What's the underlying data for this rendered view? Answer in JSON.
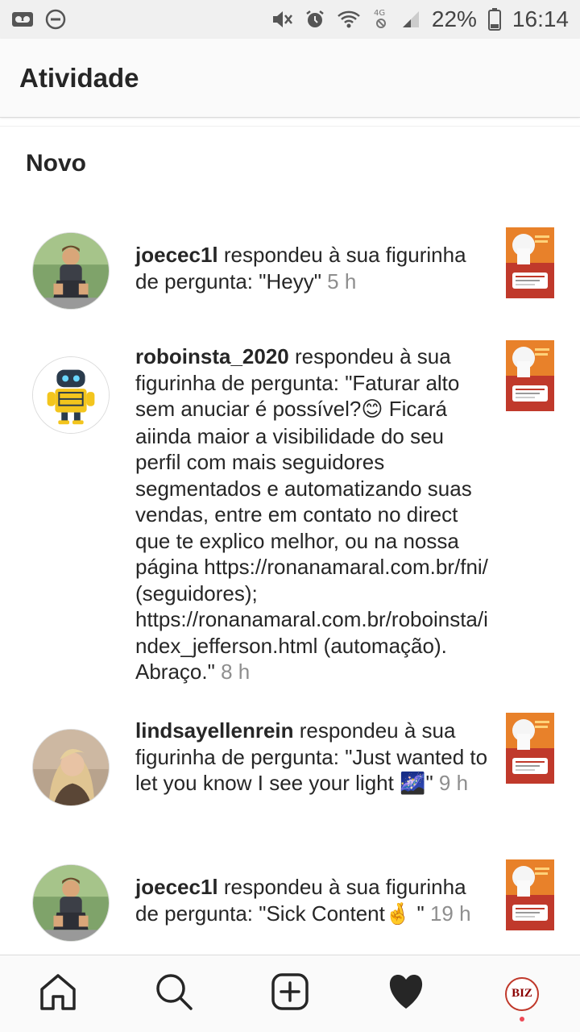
{
  "status_bar": {
    "battery_percent": "22%",
    "time": "16:14",
    "network": "4G"
  },
  "header": {
    "title": "Atividade"
  },
  "section": {
    "title": "Novo"
  },
  "activities": [
    {
      "username": "joecec1l",
      "text": " respondeu à sua figurinha de pergunta: \"Heyy\" ",
      "time": "5 h"
    },
    {
      "username": "roboinsta_2020",
      "text": " respondeu à sua figurinha de pergunta: \"Faturar alto sem anuciar é possível?",
      "emoji": "😊",
      "text2": " Ficará aiinda maior a visibilidade do seu perfil com mais seguidores segmentados e automatizando suas vendas, entre em contato no direct que te explico melhor, ou na nossa página https://ronanamaral.com.br/fni/ (seguidores); https://ronanamaral.com.br/roboinsta/index_jefferson.html (automação). Abraço.\" ",
      "time": "8 h"
    },
    {
      "username": "lindsayellenrein",
      "text": " respondeu à sua figurinha de pergunta: \"Just wanted to let you know I see your light ",
      "emoji": "🌌",
      "text2": "\" ",
      "time": "9 h"
    },
    {
      "username": "joecec1l",
      "text": " respondeu à sua figurinha de pergunta: \"Sick Content",
      "emoji": "🤞",
      "text2": " \" ",
      "time": "19 h"
    }
  ],
  "bottom_nav": {
    "items": [
      "home-icon",
      "search-icon",
      "new-post-icon",
      "activity-heart-icon",
      "profile-icon"
    ],
    "profile_label": "BIZ"
  },
  "colors": {
    "thumb_red": "#c0392b",
    "thumb_orange": "#e8812a",
    "badge_dot": "#ed4956",
    "secondary_text": "#8e8e8e"
  }
}
